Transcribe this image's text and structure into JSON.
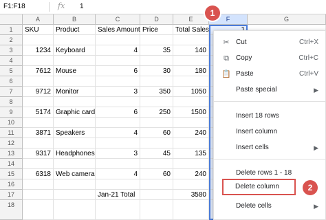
{
  "formula_bar": {
    "name_box": "F1:F18",
    "fx_label": "fx",
    "value": "1"
  },
  "columns": [
    "A",
    "B",
    "C",
    "D",
    "E",
    "F",
    "G"
  ],
  "rows": [
    "1",
    "2",
    "3",
    "4",
    "5",
    "6",
    "7",
    "8",
    "9",
    "10",
    "11",
    "12",
    "13",
    "14",
    "15",
    "16",
    "17",
    "18"
  ],
  "headers": [
    "SKU",
    "Product",
    "Sales Amount",
    "Price",
    "Total Sales"
  ],
  "data_rows": [
    {
      "row": "3",
      "sku": "1234",
      "product": "Keyboard",
      "amount": "4",
      "price": "35",
      "total": "140"
    },
    {
      "row": "5",
      "sku": "7612",
      "product": "Mouse",
      "amount": "6",
      "price": "30",
      "total": "180"
    },
    {
      "row": "7",
      "sku": "9712",
      "product": "Monitor",
      "amount": "3",
      "price": "350",
      "total": "1050"
    },
    {
      "row": "9",
      "sku": "5174",
      "product": "Graphic card",
      "amount": "6",
      "price": "250",
      "total": "1500"
    },
    {
      "row": "11",
      "sku": "3871",
      "product": "Speakers",
      "amount": "4",
      "price": "60",
      "total": "240"
    },
    {
      "row": "13",
      "sku": "9317",
      "product": "Headphones",
      "amount": "3",
      "price": "45",
      "total": "135"
    },
    {
      "row": "15",
      "sku": "6318",
      "product": "Web camera",
      "amount": "4",
      "price": "60",
      "total": "240"
    }
  ],
  "total_row": {
    "label": "Jan-21 Total",
    "value": "3580"
  },
  "f1_value": "1",
  "badges": {
    "one": "1",
    "two": "2"
  },
  "context_menu": {
    "cut": {
      "label": "Cut",
      "shortcut": "Ctrl+X",
      "icon": "scissors-icon"
    },
    "copy": {
      "label": "Copy",
      "shortcut": "Ctrl+C",
      "icon": "copy-icon"
    },
    "paste": {
      "label": "Paste",
      "shortcut": "Ctrl+V",
      "icon": "clipboard-icon"
    },
    "paste_special": {
      "label": "Paste special"
    },
    "insert_rows": {
      "label": "Insert 18 rows"
    },
    "insert_column": {
      "label": "Insert column"
    },
    "insert_cells": {
      "label": "Insert cells"
    },
    "delete_rows": {
      "label": "Delete rows 1 - 18"
    },
    "delete_column": {
      "label": "Delete column"
    },
    "delete_cells": {
      "label": "Delete cells"
    }
  },
  "colors": {
    "selection": "#4a7cdb",
    "badge": "#d9534f",
    "header_bg": "#f3f3f3"
  }
}
